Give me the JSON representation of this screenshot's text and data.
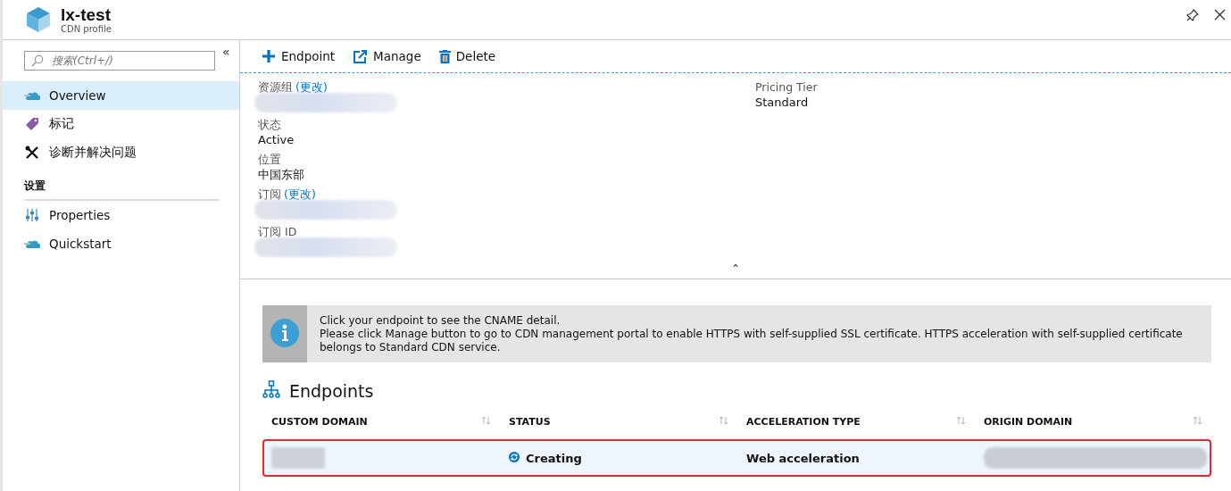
{
  "header": {
    "title": "lx-test",
    "subtitle": "CDN profile"
  },
  "sidebar": {
    "search": {
      "placeholder": "搜索(Ctrl+/)"
    },
    "collapse": "«",
    "items": [
      {
        "label": "Overview",
        "selected": true
      },
      {
        "label": "标记",
        "selected": false
      },
      {
        "label": "诊断并解决问题",
        "selected": false
      },
      {
        "kind": "heading",
        "label": "设置"
      },
      {
        "label": "Properties",
        "selected": false
      },
      {
        "label": "Quickstart",
        "selected": false
      }
    ]
  },
  "toolbar": [
    {
      "label": "Endpoint"
    },
    {
      "label": "Manage"
    },
    {
      "label": "Delete"
    }
  ],
  "essentials": {
    "left": [
      {
        "label": "资源组",
        "link": "(更改)",
        "redacted": true
      },
      {
        "label": "状态",
        "value": "Active"
      },
      {
        "label": "位置",
        "value": "中国东部"
      },
      {
        "label": "订阅",
        "link": "(更改)",
        "redacted": true
      },
      {
        "label": "订阅 ID",
        "redacted": true
      }
    ],
    "right": [
      {
        "label": "Pricing Tier",
        "value": "Standard"
      }
    ],
    "toggle": "⌃"
  },
  "info": {
    "lines": [
      "Click your endpoint to see the CNAME detail.",
      "Please click Manage button to go to CDN management portal to enable HTTPS with self-supplied SSL certificate. HTTPS acceleration with self-supplied certificate belongs to Standard CDN service."
    ]
  },
  "endpoints": {
    "title": "Endpoints",
    "columns": [
      "CUSTOM DOMAIN",
      "STATUS",
      "ACCELERATION TYPE",
      "ORIGIN DOMAIN"
    ],
    "rows": [
      {
        "custom_domain_redacted": true,
        "status": "Creating",
        "acceleration_type": "Web acceleration",
        "origin_domain_redacted": true,
        "selected": true
      }
    ]
  }
}
